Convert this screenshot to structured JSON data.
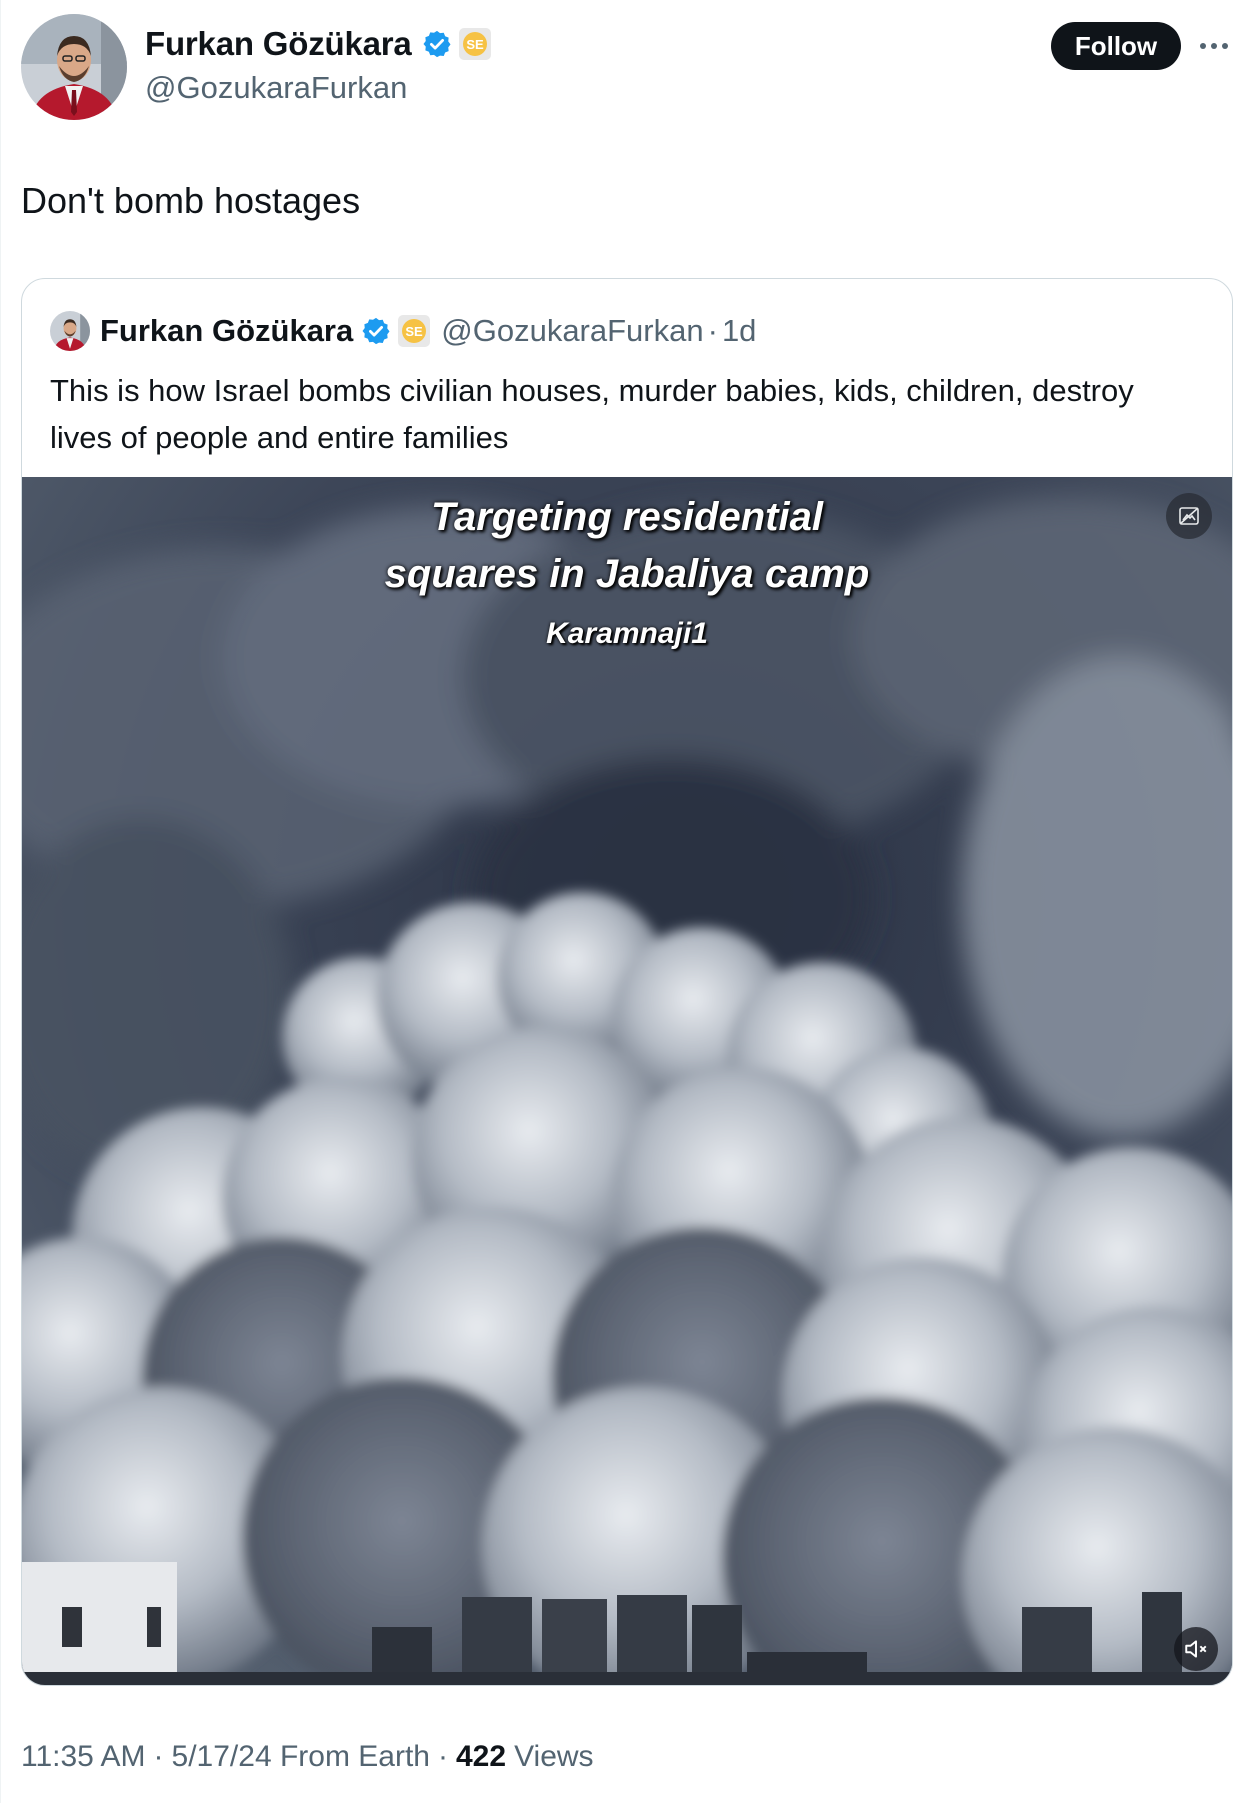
{
  "author": {
    "display_name": "Furkan Gözükara",
    "handle": "@GozukaraFurkan",
    "affiliation_badge": "SE",
    "verified_color": "#1d9bf0"
  },
  "actions": {
    "follow_label": "Follow"
  },
  "tweet": {
    "text": "Don't bomb hostages"
  },
  "quoted_tweet": {
    "display_name": "Furkan Gözükara",
    "handle": "@GozukaraFurkan",
    "separator": "·",
    "time": "1d",
    "affiliation_badge": "SE",
    "text": "This is how Israel bombs civilian houses, murder babies, kids, children, destroy lives of people and entire families",
    "media": {
      "overlay_title_line1": "Targeting residential",
      "overlay_title_line2": "squares in Jabaliya camp",
      "overlay_credit": "Karamnaji1"
    }
  },
  "meta": {
    "time": "11:35 AM",
    "separator": "·",
    "date_source": "5/17/24 From Earth",
    "views_count": "422",
    "views_label": "Views"
  },
  "icons": {
    "verified": "verified-checkmark-icon",
    "more": "more-dots-icon",
    "alt": "alt-text-icon",
    "mute": "muted-speaker-icon"
  }
}
